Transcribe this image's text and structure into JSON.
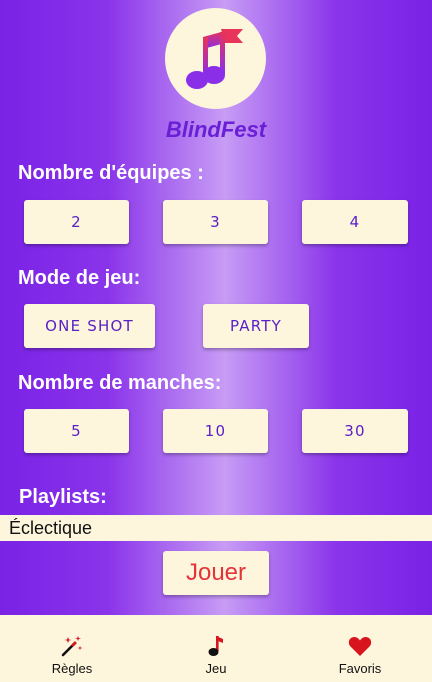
{
  "app": {
    "title": "BlindFest",
    "logo_icon": "music-notes-flag-icon"
  },
  "teams": {
    "label": "Nombre d'équipes :",
    "options": [
      "2",
      "3",
      "4"
    ]
  },
  "game_mode": {
    "label": "Mode de jeu:",
    "options": [
      "ONE SHOT",
      "PARTY"
    ]
  },
  "rounds": {
    "label": "Nombre de manches:",
    "options": [
      "5",
      "10",
      "30"
    ]
  },
  "playlists": {
    "label": "Playlists:",
    "selected": "Éclectique"
  },
  "play_button": {
    "label": "Jouer"
  },
  "bottom_nav": {
    "items": [
      {
        "label": "Règles",
        "icon": "magic-wand-icon"
      },
      {
        "label": "Jeu",
        "icon": "music-note-icon"
      },
      {
        "label": "Favoris",
        "icon": "heart-icon"
      }
    ]
  },
  "colors": {
    "background_edge": "#7a22e6",
    "background_center": "#c79cf5",
    "button_bg": "#fdf5dc",
    "button_text": "#5a20c8",
    "play_text": "#e5333a",
    "accent_red": "#d8141e"
  }
}
